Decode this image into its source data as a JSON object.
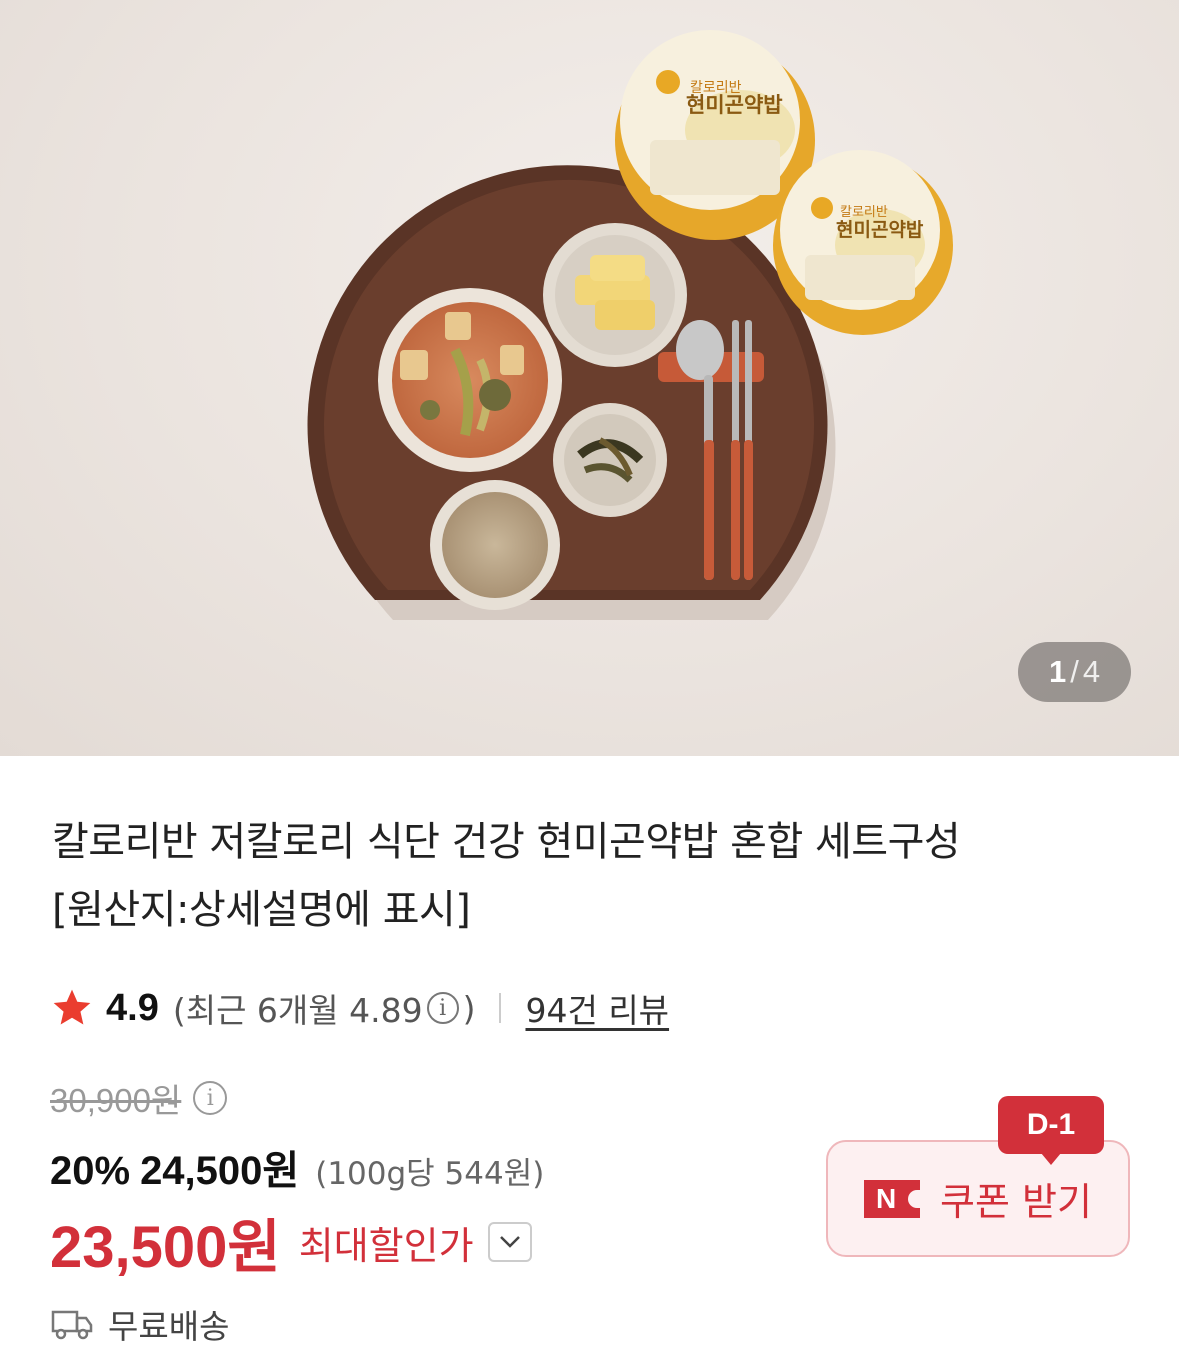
{
  "gallery": {
    "current": "1",
    "separator": "/",
    "total": "4",
    "package_brand": "칼로리반",
    "package_name": "현미곤약밥"
  },
  "product": {
    "title_line1": "칼로리반 저칼로리 식단 건강 현미곤약밥 혼합 세트구성",
    "title_line2": "[원산지:상세설명에 표시]"
  },
  "rating": {
    "icon": "star-icon",
    "score": "4.9",
    "recent_prefix": "(최근 6개월 4.89",
    "recent_suffix": ")",
    "info_glyph": "i",
    "reviews": "94건 리뷰"
  },
  "price": {
    "original": "30,900원",
    "discount_percent": "20%",
    "sale_price": "24,500원",
    "unit_price": "(100g당 544원)",
    "max_discount_price": "23,500원",
    "max_discount_label": "최대할인가"
  },
  "coupon": {
    "dday": "D-1",
    "badge": "N",
    "label": "쿠폰 받기"
  },
  "shipping": {
    "icon": "truck-icon",
    "label": "무료배송"
  },
  "colors": {
    "accent": "#d2303a",
    "coupon_bg": "#fdf0f1"
  }
}
